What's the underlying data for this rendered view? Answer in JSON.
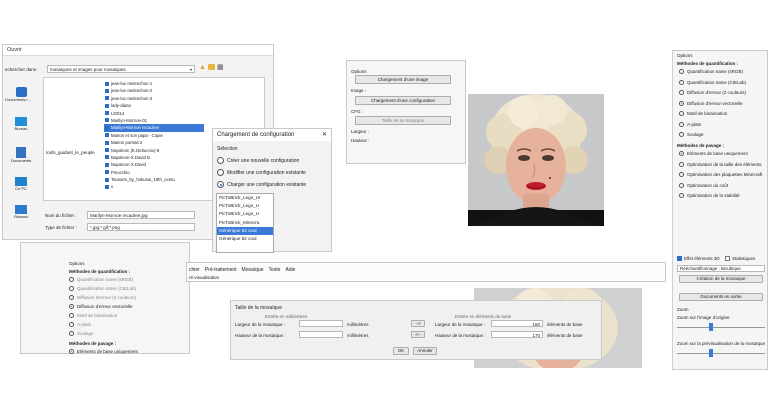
{
  "open_dialog": {
    "title": "Ouvrir",
    "search_in_label": "echercher dans :",
    "folder": "mosaiques et images pour mosaiques",
    "places": [
      "Documents r...",
      "Bureau",
      "Documents",
      "Ce PC",
      "Réseau"
    ],
    "files": [
      "jean-luc-melenchon-1",
      "jean-luc-melenchon-2",
      "jean-luc-melenchon-3",
      "lady-diana",
      "LDD14",
      "Marilyn-Monroe-01",
      "Marilyn-Monroe recadree",
      "Marion et son papa - Copie",
      "Marion portrait 2",
      "Napoleon (E.Delacroix)-8",
      "Napoleon-X.David B",
      "Napoleon-X.David",
      "Pinocchio",
      "Tsunami_by_hokusai_19th_centu",
      "v"
    ],
    "selected_index": 6,
    "side_text": "toshi_guidant_le_peuple",
    "filename_label": "Nom du fichier :",
    "filename_value": "Marilyn-Monroe recadree.jpg",
    "filetype_label": "Type de fichier :",
    "filetype_value": "*.jpg;*.gif;*.png"
  },
  "config_dialog": {
    "title": "Chargement de configuration",
    "close": "✕",
    "section": "Sélection",
    "options": [
      "Créer une nouvelle configuration",
      "Modifier une configuration existante",
      "Charger une configuration existante"
    ],
    "selected_option": 2,
    "configs": [
      "PicToBrick_Lego_Ur",
      "PicToBrick_Lego_U",
      "PicToBrick_Lego_U",
      "PicToBrick_Minecra",
      "Générique 52 coul",
      "Générique 52 coul"
    ],
    "selected_config": 4
  },
  "options_panel": {
    "title": "Options",
    "image_label": "Image :",
    "load_image": "Chargement d'une image",
    "load_config": "Chargement d'une configuration",
    "config_label": "CFG :",
    "mosaic_size_button": "Taille de la mosaïque",
    "width_label": "Largeur :",
    "height_label": "Hauteur :"
  },
  "right_panel": {
    "title": "Options",
    "quant_header": "Méthodes de quantification :",
    "quant_methods": [
      "Quantification naïve (sRGB)",
      "Quantification naïve (CIELab)",
      "Diffusion d'erreur (2 couleurs)",
      "Diffusion d'erreur vectorielle",
      "Motif de binarisation",
      "A-plats",
      "Soulage"
    ],
    "quant_selected": 3,
    "paving_header": "Méthodes de pavage :",
    "paving_methods": [
      "Eléments de base uniquement",
      "Optimisation de la taille des éléments",
      "Optimisation des plaquettes Minecraft",
      "Optimisation du coût",
      "Optimisation de la stabilité"
    ],
    "paving_selected": 0,
    "effect_3d": "Effet éléments 3D",
    "statistics": "Statistiques",
    "interp_label": "Rééchantillonnage : Bicubique",
    "create_mosaic": "Création de la mosaïque",
    "docs_output": "Documents en sortie",
    "zoom_header": "Zoom",
    "zoom_original": "Zoom sur l'image d'origine",
    "zoom_preview": "Zoom sur la prévisualisation de la mosaïque"
  },
  "mini_options": {
    "title": "Options",
    "quant_header": "Méthodes de quantification :",
    "quant_methods": [
      "Quantification naïve (sRGB)",
      "Quantification naïve (CIELab)",
      "Diffusion d'erreur (2 couleurs)",
      "Diffusion d'erreur vectorielle",
      "Motif de binarisation",
      "A-plats",
      "Soulage"
    ],
    "quant_selected": 3,
    "paving_header": "Méthodes de pavage :",
    "paving_first": "Eléments de base uniquement"
  },
  "menubar": {
    "items": [
      "chier",
      "Pré-traitement",
      "Mosaïque",
      "Texte",
      "Aide"
    ],
    "subtitle": "ré-visualisation"
  },
  "size_dialog": {
    "title": "Taille de la mosaïque",
    "left_header": "Entrée en millimètres",
    "right_header": "Entrée en éléments de base",
    "width_mm_label": "Largeur de la mosaïque :",
    "height_mm_label": "Hauteur de la mosaïque :",
    "unit_mm": "millimètres",
    "arrow_top": "-->",
    "arrow_bottom": "<--",
    "width_el_label": "Largeur de la mosaïque :",
    "height_el_label": "Hauteur de la mosaïque :",
    "width_el_value": "160",
    "height_el_value": "170",
    "unit_el": "éléments de base",
    "ok": "OK",
    "cancel": "Annuler"
  },
  "colors": {
    "selection": "#3a79d6",
    "blue_icon": "#2c6cc4",
    "slider": "#3a7bd5"
  }
}
